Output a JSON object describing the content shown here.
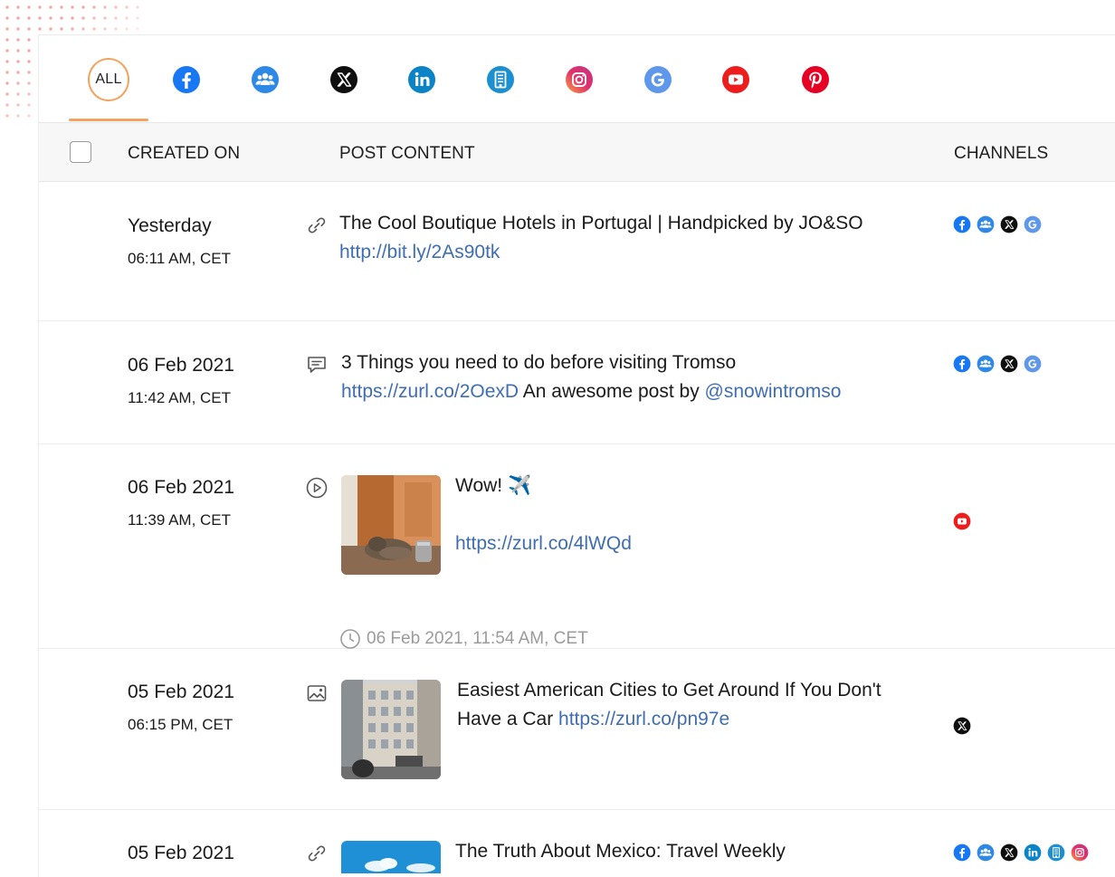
{
  "tabs": [
    {
      "id": "all",
      "label": "ALL",
      "active": true
    },
    {
      "id": "facebook",
      "icon": "facebook-icon"
    },
    {
      "id": "groups",
      "icon": "groups-icon"
    },
    {
      "id": "x",
      "icon": "x-icon"
    },
    {
      "id": "linkedin",
      "icon": "linkedin-icon"
    },
    {
      "id": "business",
      "icon": "building-icon"
    },
    {
      "id": "instagram",
      "icon": "instagram-icon"
    },
    {
      "id": "google",
      "icon": "google-icon"
    },
    {
      "id": "youtube",
      "icon": "youtube-icon"
    },
    {
      "id": "pinterest",
      "icon": "pinterest-icon"
    }
  ],
  "table": {
    "headers": {
      "created_on": "CREATED ON",
      "post_content": "POST CONTENT",
      "channels": "CHANNELS"
    }
  },
  "posts": [
    {
      "date": "Yesterday",
      "time": "06:11 AM, CET",
      "type": "link-icon",
      "title": "The Cool Boutique Hotels in Portugal | Handpicked by JO&SO",
      "url": "http://bit.ly/2As90tk",
      "channels": [
        "facebook",
        "groups",
        "x",
        "google"
      ]
    },
    {
      "date": "06 Feb 2021",
      "time": "11:42 AM, CET",
      "type": "comment-icon",
      "title": "3 Things you need to do before visiting Tromso",
      "url": "https://zurl.co/2OexD",
      "mid_text": " An awesome post by ",
      "mention": "@snowintromso",
      "channels": [
        "facebook",
        "groups",
        "x",
        "google"
      ]
    },
    {
      "date": "06 Feb 2021",
      "time": "11:39 AM, CET",
      "type": "video-icon",
      "title": "Wow! ✈️",
      "url": "https://zurl.co/4lWQd",
      "scheduled": "06 Feb 2021, 11:54 AM, CET",
      "channels": [
        "youtube"
      ]
    },
    {
      "date": "05 Feb 2021",
      "time": "06:15 PM, CET",
      "type": "image-icon",
      "title_line1": "Easiest American Cities to Get Around If You Don't",
      "title_line2": "Have a Car ",
      "url": "https://zurl.co/pn97e",
      "channels": [
        "x"
      ]
    },
    {
      "date": "05 Feb 2021",
      "type": "link-icon",
      "title": "The Truth About Mexico: Travel Weekly",
      "channels": [
        "facebook",
        "groups",
        "x",
        "linkedin",
        "business",
        "instagram"
      ]
    }
  ],
  "colors": {
    "accent": "#f2a35e",
    "link": "#3f6db3",
    "facebook": "#1877f2",
    "groups": "#2d88e6",
    "linkedin": "#0a84c6",
    "business": "#1b8fd0",
    "instagram": "#e1306c",
    "youtube": "#ff0000",
    "pinterest": "#e60023"
  }
}
